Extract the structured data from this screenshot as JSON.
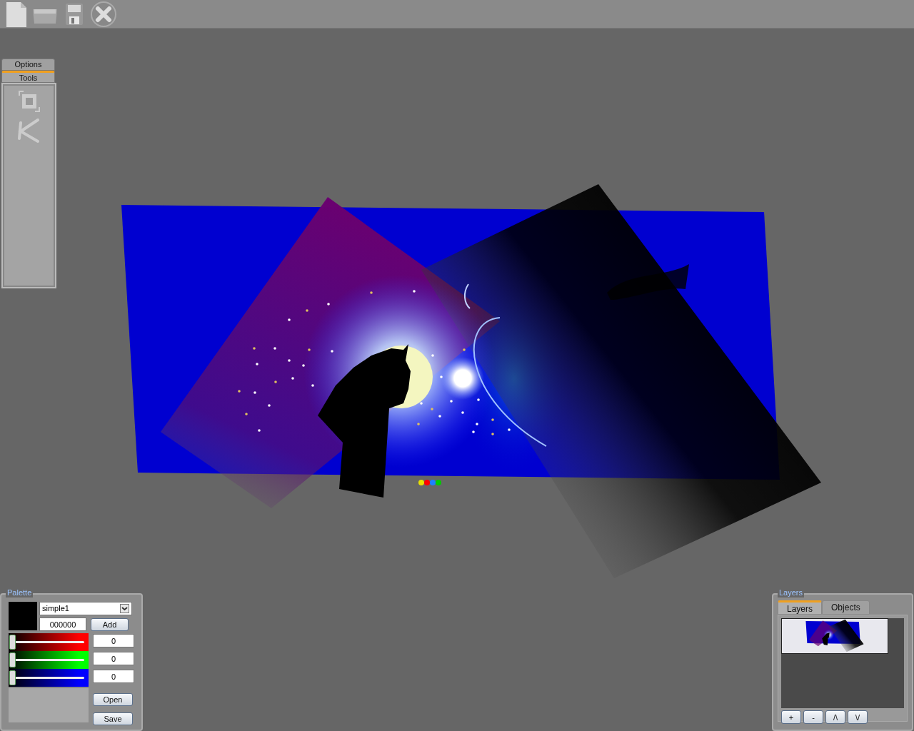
{
  "tools_panel": {
    "tabs": [
      {
        "label": "Options",
        "selected": false
      },
      {
        "label": "Tools",
        "selected": true
      }
    ]
  },
  "canvas": {
    "handles": [
      {
        "color": "#e8e000"
      },
      {
        "color": "#ff0000"
      },
      {
        "color": "#1e7fff"
      },
      {
        "color": "#00cc00"
      }
    ]
  },
  "palette": {
    "title": "Palette",
    "preset": "simple1",
    "hex": "000000",
    "add_button": "Add",
    "channels": [
      {
        "color": "#ff0000",
        "level": 0,
        "value": "0"
      },
      {
        "color": "#00ff00",
        "level": 0,
        "value": "0"
      },
      {
        "color": "#0000ff",
        "level": 0,
        "value": "0"
      }
    ],
    "open_button": "Open",
    "save_button": "Save"
  },
  "layers": {
    "title": "Layers",
    "tabs": [
      {
        "label": "Layers",
        "selected": true
      },
      {
        "label": "Objects",
        "selected": false
      }
    ],
    "buttons": [
      "+",
      "-",
      "/\\",
      "\\/"
    ]
  }
}
